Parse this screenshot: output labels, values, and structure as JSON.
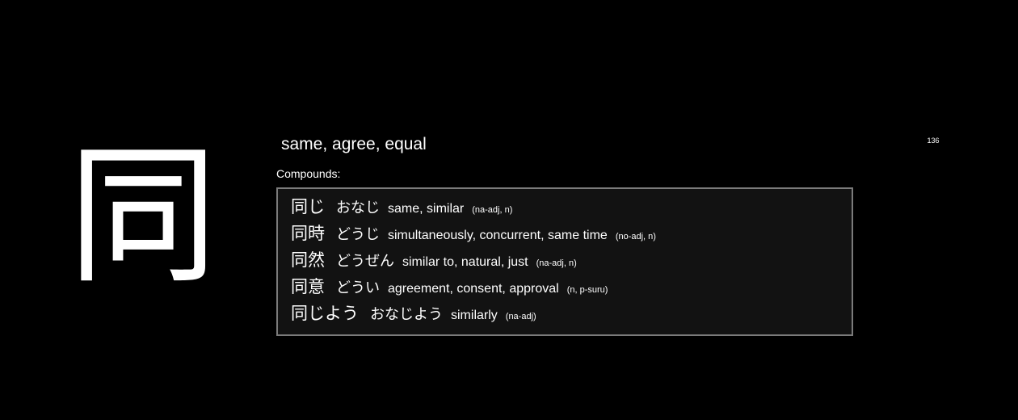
{
  "kanji": {
    "character": "同",
    "meaning": "same, agree, equal",
    "counter": "136"
  },
  "compounds": {
    "label": "Compounds:",
    "items": [
      {
        "word": "同じ",
        "reading": "おなじ",
        "gloss": "same, similar",
        "pos": "(na-adj, n)"
      },
      {
        "word": "同時",
        "reading": "どうじ",
        "gloss": "simultaneously, concurrent, same time",
        "pos": "(no-adj, n)"
      },
      {
        "word": "同然",
        "reading": "どうぜん",
        "gloss": "similar to, natural, just",
        "pos": "(na-adj, n)"
      },
      {
        "word": "同意",
        "reading": "どうい",
        "gloss": "agreement, consent, approval",
        "pos": "(n, p-suru)"
      },
      {
        "word": "同じよう",
        "reading": "おなじよう",
        "gloss": "similarly",
        "pos": "(na-adj)"
      }
    ]
  }
}
